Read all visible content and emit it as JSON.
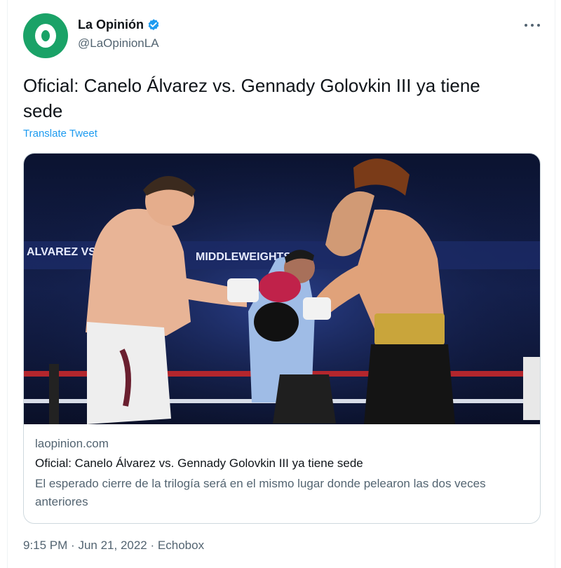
{
  "account": {
    "display_name": "La Opinión",
    "handle": "@LaOpinionLA",
    "verified": true,
    "avatar_color": "#1aa267",
    "verified_color": "#1d9bf0"
  },
  "tweet": {
    "text": "Oficial: Canelo Álvarez vs. Gennady Golovkin III ya tiene sede",
    "translate_label": "Translate Tweet"
  },
  "card": {
    "image_banner_1": "ALVAREZ VS GENN",
    "image_banner_2": "MIDDLEWEIGHTS",
    "domain": "laopinion.com",
    "title": "Oficial: Canelo Álvarez vs. Gennady Golovkin III ya tiene sede",
    "description": "El esperado cierre de la trilogía será en el mismo lugar donde pelearon las dos veces anteriores"
  },
  "meta": {
    "time": "9:15 PM",
    "separator": "·",
    "date": "Jun 21, 2022",
    "source": "Echobox"
  },
  "icons": {
    "more": "more-horizontal-icon",
    "verified": "verified-badge-icon"
  }
}
